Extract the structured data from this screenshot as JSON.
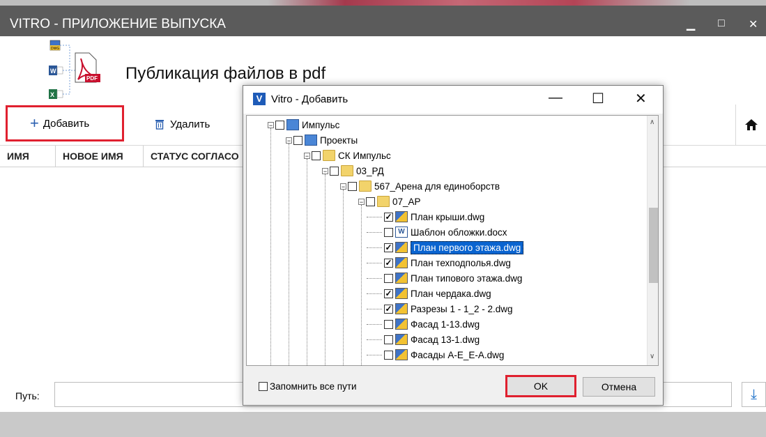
{
  "window": {
    "title": "VITRO - ПРИЛОЖЕНИЕ ВЫПУСКА",
    "controls": {
      "minimize": "▁",
      "maximize": "□",
      "close": "✕"
    }
  },
  "header": {
    "title": "Публикация файлов в pdf",
    "badge_dwg": "DWG",
    "badge_pdf": "PDF"
  },
  "toolbar": {
    "add_label": "Добавить",
    "delete_label": "Удалить",
    "home_icon": "home-icon"
  },
  "columns": [
    "ИМЯ",
    "НОВОЕ ИМЯ",
    "СТАТУС СОГЛАСО"
  ],
  "path": {
    "label": "Путь:",
    "value": ""
  },
  "dialog": {
    "logo": "V",
    "title": "Vitro - Добавить",
    "controls": {
      "minimize": "—",
      "maximize": "☐",
      "close": "✕"
    },
    "tree": [
      {
        "label": "Импульс",
        "level": 0,
        "type": "proj",
        "checked": false
      },
      {
        "label": "Проекты",
        "level": 1,
        "type": "proj",
        "checked": false
      },
      {
        "label": "СК Импульс",
        "level": 2,
        "type": "folder",
        "checked": false
      },
      {
        "label": "03_РД",
        "level": 3,
        "type": "folder",
        "checked": false
      },
      {
        "label": "567_Арена для единоборств",
        "level": 4,
        "type": "folder",
        "checked": false
      },
      {
        "label": "07_АР",
        "level": 5,
        "type": "folder",
        "checked": false
      },
      {
        "label": "План крыши.dwg",
        "level": 6,
        "type": "dwg",
        "checked": true
      },
      {
        "label": "Шаблон обложки.docx",
        "level": 6,
        "type": "docx",
        "checked": false
      },
      {
        "label": "План первого этажа.dwg",
        "level": 6,
        "type": "dwg",
        "checked": true,
        "selected": true
      },
      {
        "label": "План техподполья.dwg",
        "level": 6,
        "type": "dwg",
        "checked": true
      },
      {
        "label": "План типового этажа.dwg",
        "level": 6,
        "type": "dwg",
        "checked": false
      },
      {
        "label": "План чердака.dwg",
        "level": 6,
        "type": "dwg",
        "checked": true
      },
      {
        "label": "Разрезы 1 - 1_2 - 2.dwg",
        "level": 6,
        "type": "dwg",
        "checked": true
      },
      {
        "label": "Фасад 1-13.dwg",
        "level": 6,
        "type": "dwg",
        "checked": false
      },
      {
        "label": "Фасад 13-1.dwg",
        "level": 6,
        "type": "dwg",
        "checked": false
      },
      {
        "label": "Фасады А-Е_Е-А.dwg",
        "level": 6,
        "type": "dwg",
        "checked": false
      }
    ],
    "remember_label": "Запомнить все пути",
    "ok_label": "OK",
    "cancel_label": "Отмена"
  },
  "colors": {
    "titlebar": "#5b5b5b",
    "highlight": "#e0202f",
    "selection": "#0a64d0"
  }
}
